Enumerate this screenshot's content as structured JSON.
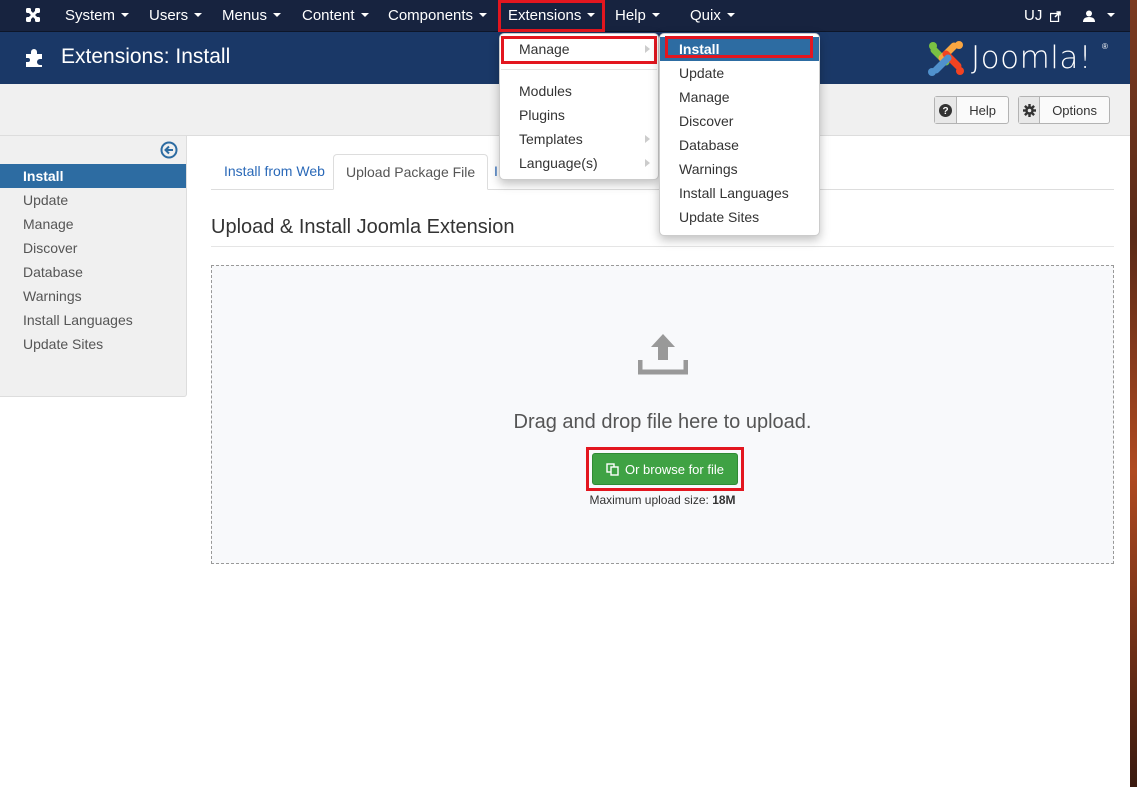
{
  "navbar": {
    "logo_icon": "joomla-icon",
    "items": [
      {
        "label": "System"
      },
      {
        "label": "Users"
      },
      {
        "label": "Menus"
      },
      {
        "label": "Content"
      },
      {
        "label": "Components"
      },
      {
        "label": "Extensions"
      },
      {
        "label": "Help"
      },
      {
        "label": "Quix"
      }
    ],
    "site_link": "UJ",
    "site_link_icon": "external-link-icon",
    "user_icon": "user-icon"
  },
  "header": {
    "icon": "puzzle-icon",
    "title": "Extensions: Install",
    "brand": "Joomla!",
    "brand_reg": "®"
  },
  "toolbar": {
    "help_label": "Help",
    "options_label": "Options"
  },
  "sidebar": {
    "toggle_icon": "arrow-left-circle-icon",
    "items": [
      {
        "label": "Install",
        "active": true
      },
      {
        "label": "Update"
      },
      {
        "label": "Manage"
      },
      {
        "label": "Discover"
      },
      {
        "label": "Database"
      },
      {
        "label": "Warnings"
      },
      {
        "label": "Install Languages"
      },
      {
        "label": "Update Sites"
      }
    ]
  },
  "tabs": [
    {
      "label": "Install from Web"
    },
    {
      "label": "Upload Package File",
      "active": true
    },
    {
      "label": "I"
    }
  ],
  "main": {
    "section_title": "Upload & Install Joomla Extension",
    "upload_icon": "upload-icon",
    "drop_text": "Drag and drop file here to upload.",
    "browse_label": "Or browse for file",
    "max_size_label": "Maximum upload size:",
    "max_size_value": "18M"
  },
  "extensions_menu": {
    "items": [
      {
        "label": "Manage",
        "has_submenu": true
      },
      {
        "label": "Modules"
      },
      {
        "label": "Plugins"
      },
      {
        "label": "Templates",
        "has_submenu": true
      },
      {
        "label": "Language(s)",
        "has_submenu": true
      }
    ]
  },
  "manage_submenu": {
    "items": [
      {
        "label": "Install",
        "active": true
      },
      {
        "label": "Update"
      },
      {
        "label": "Manage"
      },
      {
        "label": "Discover"
      },
      {
        "label": "Database"
      },
      {
        "label": "Warnings"
      },
      {
        "label": "Install Languages"
      },
      {
        "label": "Update Sites"
      }
    ]
  },
  "colors": {
    "navbar_bg": "#17233f",
    "header_bg": "#1a3867",
    "active_blue": "#2d6ca2",
    "browse_green": "#3fa244",
    "highlight_red": "#e3161f"
  }
}
